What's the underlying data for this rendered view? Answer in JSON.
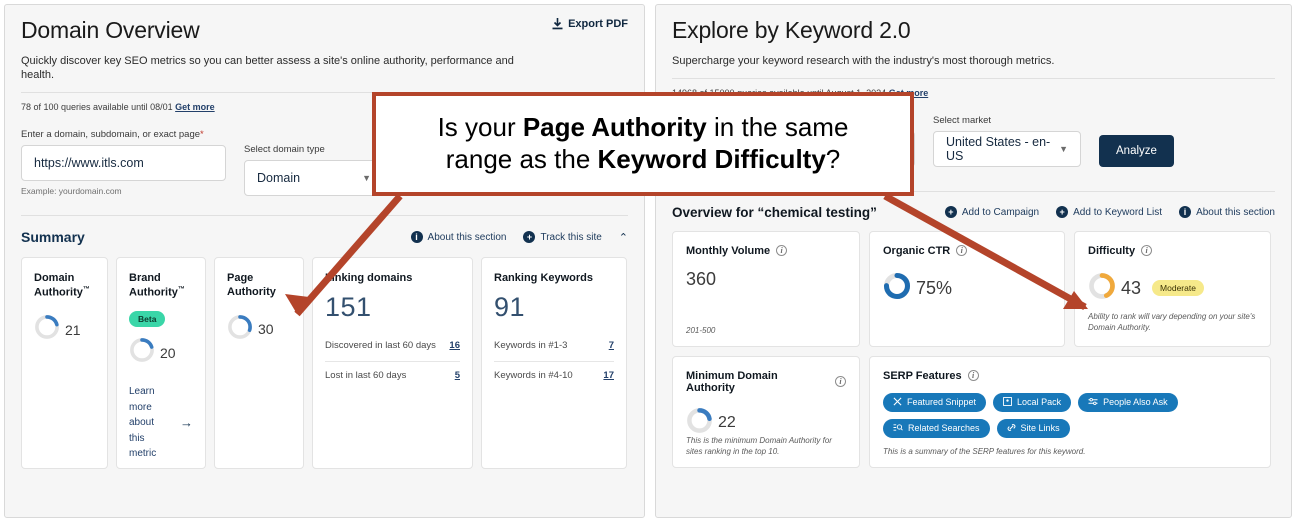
{
  "left": {
    "title": "Domain Overview",
    "subtitle": "Quickly discover key SEO metrics so you can better assess a site's online authority, performance and health.",
    "export_label": "Export PDF",
    "quota": "78 of 100 queries available until 08/01",
    "quota_link": "Get more",
    "domain_field_label": "Enter a domain, subdomain, or exact page",
    "domain_value": "https://www.itls.com",
    "domain_hint": "Example: yourdomain.com",
    "type_field_label": "Select domain type",
    "type_value": "Domain",
    "summary_title": "Summary",
    "about_label": "About this section",
    "track_label": "Track this site",
    "cards": [
      {
        "title": "Domain Authority",
        "tm": "™",
        "value": "21",
        "pct": 21
      },
      {
        "title": "Brand Authority",
        "tm": "™",
        "value": "20",
        "pct": 20,
        "badge": "Beta",
        "learn": "Learn more about this metric"
      },
      {
        "title": "Page Authority",
        "tm": "",
        "value": "30",
        "pct": 30
      }
    ],
    "linking": {
      "title": "Linking domains",
      "value": "151",
      "rows": [
        {
          "label": "Discovered in last 60 days",
          "value": "16"
        },
        {
          "label": "Lost in last 60 days",
          "value": "5"
        }
      ]
    },
    "ranking": {
      "title": "Ranking Keywords",
      "value": "91",
      "rows": [
        {
          "label": "Keywords in #1-3",
          "value": "7"
        },
        {
          "label": "Keywords in #4-10",
          "value": "17"
        }
      ]
    }
  },
  "right": {
    "title": "Explore by Keyword 2.0",
    "subtitle": "Supercharge your keyword research with the industry's most thorough metrics.",
    "quota": "14968 of 15000 queries available until August 1, 2024",
    "quota_link": "Get more",
    "market_label": "Select market",
    "market_value": "United States - en-US",
    "analyze_label": "Analyze",
    "overview_title": "Overview for “chemical testing”",
    "add_campaign": "Add to Campaign",
    "add_keyword_list": "Add to Keyword List",
    "about_label": "About this section",
    "metrics": [
      {
        "title": "Monthly Volume",
        "value": "360",
        "foot": "201-500"
      },
      {
        "title": "Organic CTR",
        "value": "75%",
        "pct": 75
      },
      {
        "title": "Difficulty",
        "value": "43",
        "badge": "Moderate",
        "pct": 43,
        "foot": "Ability to rank will vary depending on your site's Domain Authority."
      },
      {
        "title": "Minimum Domain Authority",
        "value": "22",
        "pct": 22,
        "foot": "This is the minimum Domain Authority for sites ranking in the top 10."
      }
    ],
    "serp": {
      "title": "SERP Features",
      "chips": [
        {
          "label": "Featured Snippet",
          "icon": "scissors-icon"
        },
        {
          "label": "Local Pack",
          "icon": "map-marker-box-icon"
        },
        {
          "label": "People Also Ask",
          "icon": "sliders-icon"
        },
        {
          "label": "Related Searches",
          "icon": "search-list-icon"
        },
        {
          "label": "Site Links",
          "icon": "link-icon"
        }
      ],
      "foot": "This is a summary of the SERP features for this keyword."
    }
  },
  "callout": {
    "line1_pre": "Is your ",
    "line1_bold": "Page Authority",
    "line1_post": " in the same",
    "line2_pre": "range as the ",
    "line2_bold": "Keyword Difficulty",
    "line2_post": "?"
  },
  "colors": {
    "accent_red": "#b4442a",
    "navy": "#12314f",
    "blue": "#3a7cc0",
    "chip_blue": "#1878b9",
    "orange": "#f0a93c",
    "teal": "#3ad6a8",
    "yellow": "#f6e98a"
  }
}
